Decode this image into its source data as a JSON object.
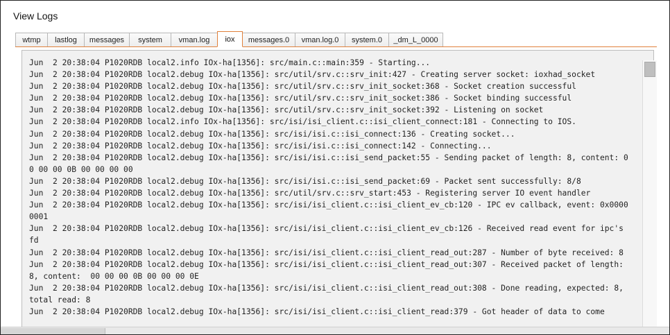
{
  "page": {
    "title": "View Logs"
  },
  "tabs": [
    {
      "label": "wtmp",
      "active": false
    },
    {
      "label": "lastlog",
      "active": false
    },
    {
      "label": "messages",
      "active": false
    },
    {
      "label": "system",
      "active": false
    },
    {
      "label": "vman.log",
      "active": false
    },
    {
      "label": "iox",
      "active": true
    },
    {
      "label": "messages.0",
      "active": false
    },
    {
      "label": "vman.log.0",
      "active": false
    },
    {
      "label": "system.0",
      "active": false
    },
    {
      "label": "_dm_L_0000",
      "active": false
    }
  ],
  "log": {
    "content": "Jun  2 20:38:04 P1020RDB local2.info IOx-ha[1356]: src/main.c::main:359 - Starting...\nJun  2 20:38:04 P1020RDB local2.debug IOx-ha[1356]: src/util/srv.c::srv_init:427 - Creating server socket: ioxhad_socket\nJun  2 20:38:04 P1020RDB local2.debug IOx-ha[1356]: src/util/srv.c::srv_init_socket:368 - Socket creation successful\nJun  2 20:38:04 P1020RDB local2.debug IOx-ha[1356]: src/util/srv.c::srv_init_socket:386 - Socket binding successful\nJun  2 20:38:04 P1020RDB local2.debug IOx-ha[1356]: src/util/srv.c::srv_init_socket:392 - Listening on socket\nJun  2 20:38:04 P1020RDB local2.info IOx-ha[1356]: src/isi/isi_client.c::isi_client_connect:181 - Connecting to IOS.\nJun  2 20:38:04 P1020RDB local2.debug IOx-ha[1356]: src/isi/isi.c::isi_connect:136 - Creating socket...\nJun  2 20:38:04 P1020RDB local2.debug IOx-ha[1356]: src/isi/isi.c::isi_connect:142 - Connecting...\nJun  2 20:38:04 P1020RDB local2.debug IOx-ha[1356]: src/isi/isi.c::isi_send_packet:55 - Sending packet of length: 8, content: 00 00 00 0B 00 00 00 00\nJun  2 20:38:04 P1020RDB local2.debug IOx-ha[1356]: src/isi/isi.c::isi_send_packet:69 - Packet sent successfully: 8/8\nJun  2 20:38:04 P1020RDB local2.debug IOx-ha[1356]: src/util/srv.c::srv_start:453 - Registering server IO event handler\nJun  2 20:38:04 P1020RDB local2.debug IOx-ha[1356]: src/isi/isi_client.c::isi_client_ev_cb:120 - IPC ev callback, event: 0x00000001\nJun  2 20:38:04 P1020RDB local2.debug IOx-ha[1356]: src/isi/isi_client.c::isi_client_ev_cb:126 - Received read event for ipc's fd\nJun  2 20:38:04 P1020RDB local2.debug IOx-ha[1356]: src/isi/isi_client.c::isi_client_read_out:287 - Number of byte received: 8\nJun  2 20:38:04 P1020RDB local2.debug IOx-ha[1356]: src/isi/isi_client.c::isi_client_read_out:307 - Received packet of length: 8, content:  00 00 00 0B 00 00 00 0E\nJun  2 20:38:04 P1020RDB local2.debug IOx-ha[1356]: src/isi/isi_client.c::isi_client_read_out:308 - Done reading, expected: 8, total read: 8\nJun  2 20:38:04 P1020RDB local2.debug IOx-ha[1356]: src/isi/isi_client.c::isi_client_read:379 - Got header of data to come"
  }
}
